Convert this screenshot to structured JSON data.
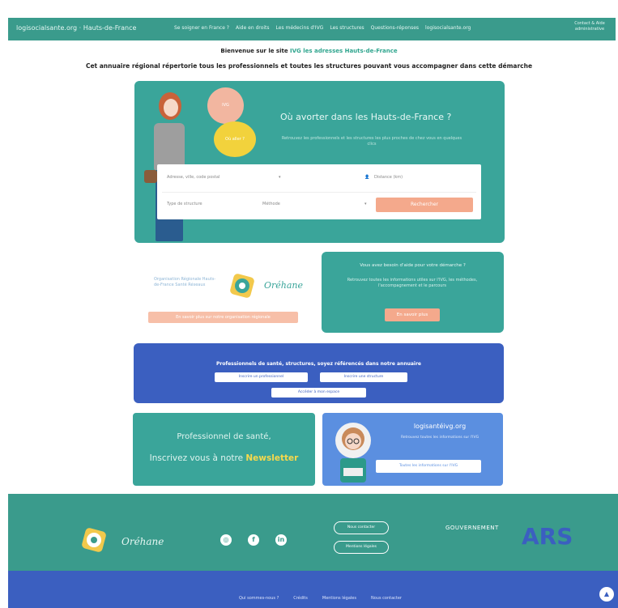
{
  "nav": {
    "brand": "logisocialsante.org · Hauts-de-France",
    "links": [
      "Se soigner en France ?",
      "Aide en droits",
      "Les médecins d'IVG",
      "Les structures",
      "Questions-réponses",
      "logisocialsante.org"
    ],
    "contact": "Contact & Aide administrative"
  },
  "intro": {
    "welcome_prefix": "Bienvenue sur le site",
    "welcome_highlight": "IVG les adresses Hauts-de-France",
    "tagline": "Cet annuaire régional répertorie tous les professionnels et toutes les structures pouvant vous accompagner dans cette démarche"
  },
  "hero": {
    "title": "Où avorter dans les Hauts-de-France ?",
    "subtitle": "Retrouvez les professionnels et les structures les plus proches de chez vous en quelques clics",
    "bubble1": "IVG",
    "bubble2": "Où aller ?",
    "search": {
      "field1": "Adresse, ville, code postal",
      "field2": "Distance (km)",
      "field3": "Type de structure",
      "field4": "Méthode",
      "button": "Rechercher"
    }
  },
  "orehane": {
    "text": "Organisation Régionale Hauts-de-France Santé Réseaux",
    "name": "Oréhane",
    "button": "En savoir plus sur notre organisation régionale"
  },
  "infocard": {
    "line1": "Vous avez besoin d'aide pour votre démarche ?",
    "line2": "Retrouvez toutes les informations utiles sur l'IVG, les méthodes, l'accompagnement et le parcours",
    "button": "En savoir plus"
  },
  "register": {
    "title": "Professionnels de santé, structures, soyez référencés dans notre annuaire",
    "btn1": "Inscrire un professionnel",
    "btn2": "Inscrire une structure",
    "btn3": "Accéder à mon espace"
  },
  "newsletter": {
    "line1": "Professionnel de santé,",
    "line2_prefix": "Inscrivez vous à notre",
    "line2_highlight": "Newsletter"
  },
  "logisante": {
    "title": "logisantéivg.org",
    "subtitle": "Retrouvez toutes les informations sur l'IVG",
    "button": "Toutes les informations sur l'IVG"
  },
  "footer": {
    "brand": "Oréhane",
    "social": [
      "◎",
      "f",
      "in"
    ],
    "btn1": "Nous contacter",
    "btn2": "Mentions légales",
    "gov": "GOUVERNEMENT",
    "ars": "ARS",
    "bottom_links": [
      "Qui sommes-nous ?",
      "Crédits",
      "Mentions légales",
      "Nous contacter"
    ],
    "fab": "▲"
  }
}
